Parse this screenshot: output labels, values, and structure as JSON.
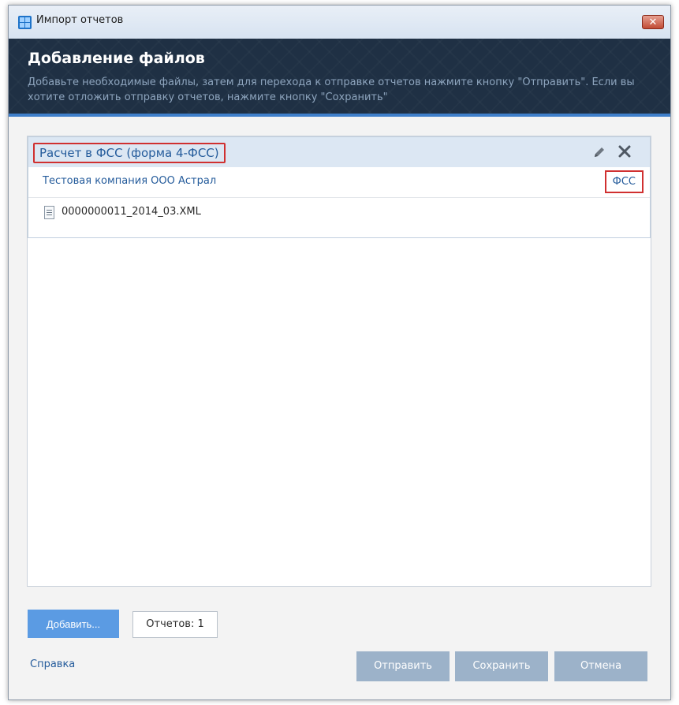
{
  "window": {
    "title": "Импорт отчетов",
    "close_label": "✕"
  },
  "banner": {
    "title": "Добавление файлов",
    "description": "Добавьте необходимые файлы, затем для перехода к отправке отчетов нажмите кнопку \"Отправить\". Если вы хотите отложить отправку отчетов, нажмите кнопку \"Сохранить\""
  },
  "report": {
    "title": "Расчет в ФСС (форма 4-ФСС)",
    "company": "Тестовая компания ООО Астрал",
    "authority": "ФСС",
    "files": [
      {
        "name": "0000000011_2014_03.XML"
      }
    ]
  },
  "footer": {
    "add_label": "Добавить...",
    "count_label": "Отчетов: 1",
    "help_label": "Справка",
    "send_label": "Отправить",
    "save_label": "Сохранить",
    "cancel_label": "Отмена"
  },
  "icons": {
    "app": "app-grid-icon",
    "edit": "pencil-icon",
    "delete": "close-icon",
    "file": "document-icon"
  },
  "colors": {
    "accent": "#3f7fca",
    "banner_bg": "#1f3044",
    "add_button": "#5b9be3",
    "disabled_button": "#9cb2c9",
    "highlight_border": "#d03030",
    "link": "#245b9b"
  }
}
